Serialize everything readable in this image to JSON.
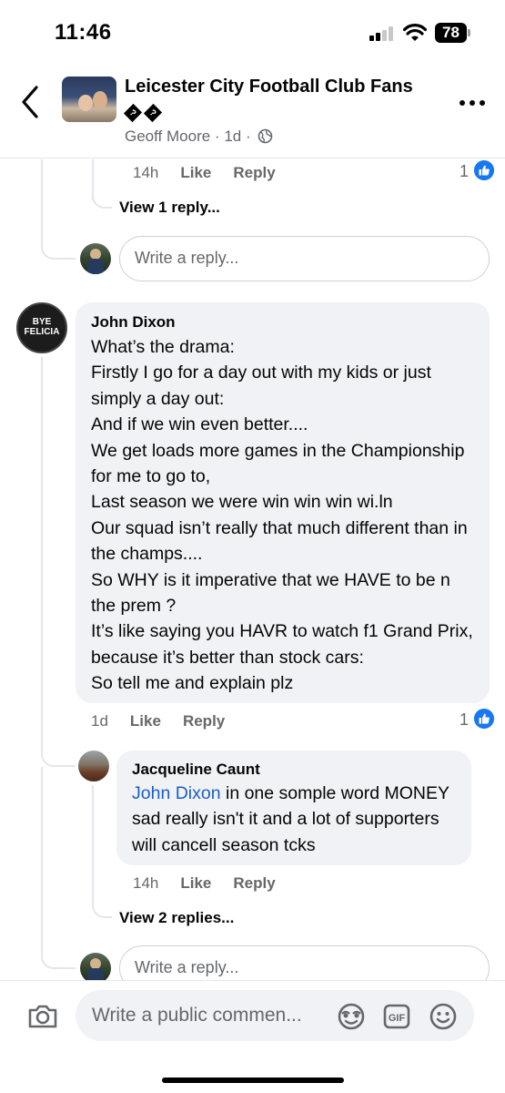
{
  "status_bar": {
    "time": "11:46",
    "battery": "78"
  },
  "header": {
    "title": "Leicester City Football Club Fans",
    "title_emoji": "��",
    "author": "Geoff Moore",
    "age": "1d",
    "separator": "·",
    "icons": {
      "back": "chevron-left-icon",
      "more": "more-dots-icon",
      "privacy": "globe-icon"
    }
  },
  "thread_top": {
    "time": "14h",
    "like_label": "Like",
    "reply_label": "Reply",
    "like_count": "1",
    "view_replies": "View 1 reply..."
  },
  "reply_input_placeholder": "Write a reply...",
  "comment_main": {
    "author": "John Dixon",
    "avatar_text": "BYE FELICIA",
    "text": "What’s the drama:\nFirstly I go for a day out with my kids or just simply a day out:\nAnd if we win even better....\nWe get loads more games in the Championship for me to go to,\nLast season we were win win win wi.ln\nOur squad isn’t really that much different than in the champs....\nSo WHY is it imperative that we HAVE to be n the prem ?\nIt’s like saying you HAVR to watch f1 Grand Prix, because it’s better than stock cars:\nSo tell me and explain plz",
    "time": "1d",
    "like_label": "Like",
    "reply_label": "Reply",
    "like_count": "1"
  },
  "comment_reply": {
    "author": "Jacqueline Caunt",
    "mention": "John Dixon",
    "text": " in one somple word MONEY sad really isn't it and a lot of supporters will cancell season tcks",
    "time": "14h",
    "like_label": "Like",
    "reply_label": "Reply",
    "view_replies": "View 2 replies..."
  },
  "bottom_bar": {
    "placeholder": "Write a public commen...",
    "icons": [
      "camera-icon",
      "avatar-sticker-icon",
      "gif-icon",
      "emoji-icon"
    ]
  },
  "colors": {
    "accent": "#1877f2",
    "bubble": "#f0f2f5",
    "muted": "#65676b",
    "mention": "#1b5fc6"
  }
}
